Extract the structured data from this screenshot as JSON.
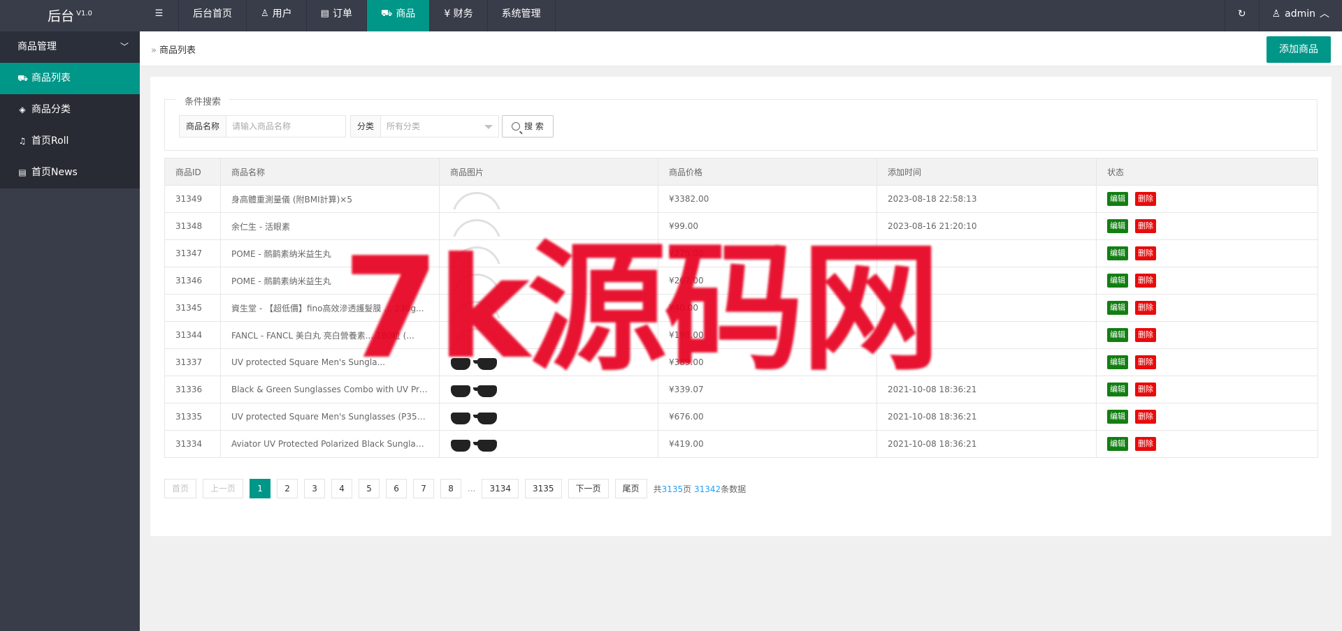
{
  "brand": {
    "name": "后台",
    "version": "V1.0"
  },
  "topnav": {
    "toggle_icon": "hamburger-icon",
    "items": [
      {
        "label": "后台首页",
        "icon": ""
      },
      {
        "label": "用户",
        "icon": "user-icon"
      },
      {
        "label": "订单",
        "icon": "document-icon"
      },
      {
        "label": "商品",
        "icon": "cart-icon",
        "active": true
      },
      {
        "label": "¥ 财务",
        "icon": ""
      },
      {
        "label": "系统管理",
        "icon": ""
      }
    ],
    "refresh_icon": "refresh-icon",
    "user": "admin"
  },
  "sidebar": {
    "group": "商品管理",
    "items": [
      {
        "label": "商品列表",
        "icon": "cart-icon",
        "active": true
      },
      {
        "label": "商品分类",
        "icon": "layers-icon"
      },
      {
        "label": "首页Roll",
        "icon": "bell-icon"
      },
      {
        "label": "首页News",
        "icon": "note-icon"
      }
    ]
  },
  "breadcrumb": {
    "current": "商品列表"
  },
  "add_button": "添加商品",
  "search": {
    "legend": "条件搜索",
    "name_label": "商品名称",
    "name_placeholder": "请输入商品名称",
    "category_label": "分类",
    "category_value": "所有分类",
    "button": "搜 索"
  },
  "table": {
    "headers": [
      "商品ID",
      "商品名称",
      "商品图片",
      "商品价格",
      "添加时间",
      "状态"
    ],
    "edit_label": "编辑",
    "delete_label": "删除",
    "rows": [
      {
        "id": "31349",
        "name": "身高體重測量儀 (附BMI計算)×5",
        "image": "placeholder",
        "price": "¥3382.00",
        "time": "2023-08-18 22:58:13"
      },
      {
        "id": "31348",
        "name": "余仁生 - 活眼素",
        "image": "placeholder",
        "price": "¥99.00",
        "time": "2023-08-16 21:20:10"
      },
      {
        "id": "31347",
        "name": "POME - 鸸鹋素纳米益生丸",
        "image": "placeholder",
        "price": "¥275.00",
        "time": ""
      },
      {
        "id": "31346",
        "name": "POME - 鸸鹋素纳米益生丸",
        "image": "placeholder",
        "price": "¥267.00",
        "time": ""
      },
      {
        "id": "31345",
        "name": "資生堂 - 【超低價】fino高效滲透護髮膜 ... 230g...",
        "image": "placeholder",
        "price": "¥40.00",
        "time": ""
      },
      {
        "id": "31344",
        "name": "FANCL - FANCL 美白丸 亮白營養素... 180粒 (...",
        "image": "placeholder",
        "price": "¥198.00",
        "time": ""
      },
      {
        "id": "31337",
        "name": "UV protected Square Men's Sungla...",
        "image": "glasses",
        "price": "¥389.00",
        "time": ""
      },
      {
        "id": "31336",
        "name": "Black & Green Sunglasses Combo with UV Protec...",
        "image": "glasses",
        "price": "¥339.07",
        "time": "2021-10-08 18:36:21"
      },
      {
        "id": "31335",
        "name": "UV protected Square Men's Sunglasses (P358BK...",
        "image": "glasses",
        "price": "¥676.00",
        "time": "2021-10-08 18:36:21"
      },
      {
        "id": "31334",
        "name": "Aviator UV Protected Polarized Black Sunglasses ...",
        "image": "glasses",
        "price": "¥419.00",
        "time": "2021-10-08 18:36:21"
      }
    ]
  },
  "pager": {
    "first": "首页",
    "prev": "上一页",
    "current": "1",
    "pages": [
      "2",
      "3",
      "4",
      "5",
      "6",
      "7",
      "8"
    ],
    "ellipsis": "...",
    "tail_pages": [
      "3134",
      "3135"
    ],
    "next": "下一页",
    "last": "尾页",
    "info_prefix": "共",
    "total_pages": "3135",
    "info_mid": "页 ",
    "total_records": "31342",
    "info_suffix": "条数据"
  },
  "watermark": "7k源码网",
  "colors": {
    "accent": "#009688",
    "header": "#393d49",
    "edit": "#137e13",
    "delete": "#e80b0b",
    "watermark": "#e60020"
  }
}
